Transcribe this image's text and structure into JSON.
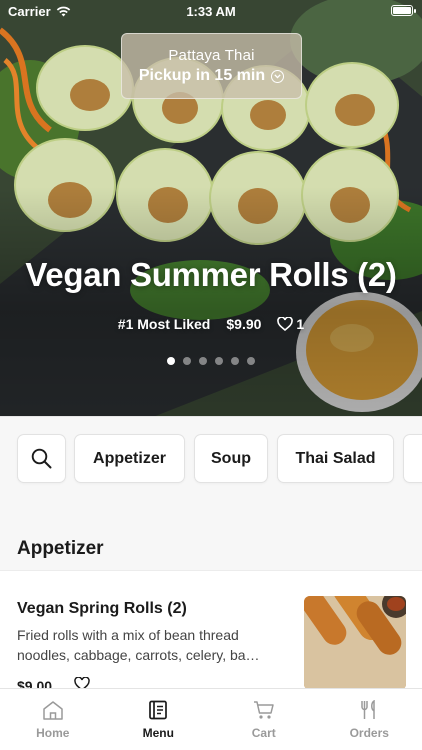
{
  "status_bar": {
    "carrier": "Carrier",
    "time": "1:33 AM"
  },
  "store": {
    "name": "Pattaya Thai",
    "pickup": "Pickup in 15 min"
  },
  "featured": {
    "title": "Vegan Summer Rolls (2)",
    "rank": "#1 Most Liked",
    "price": "$9.90",
    "likes": "1",
    "slides": 6,
    "active_slide": 1
  },
  "categories": [
    "Appetizer",
    "Soup",
    "Thai Salad"
  ],
  "section": {
    "title": "Appetizer"
  },
  "item": {
    "name": "Vegan Spring Rolls (2)",
    "description": "Fried rolls with a mix of bean thread noodles, cabbage, carrots, celery, ba…",
    "price": "$9.00"
  },
  "tabs": [
    {
      "label": "Home",
      "icon": "home-icon",
      "active": false
    },
    {
      "label": "Menu",
      "icon": "menu-book-icon",
      "active": true
    },
    {
      "label": "Cart",
      "icon": "cart-icon",
      "active": false
    },
    {
      "label": "Orders",
      "icon": "fork-knife-icon",
      "active": false
    }
  ],
  "colors": {
    "active_tab": "#1b1b1b",
    "inactive_tab": "#9a9a9a",
    "chip_border": "#e2e2e2"
  }
}
